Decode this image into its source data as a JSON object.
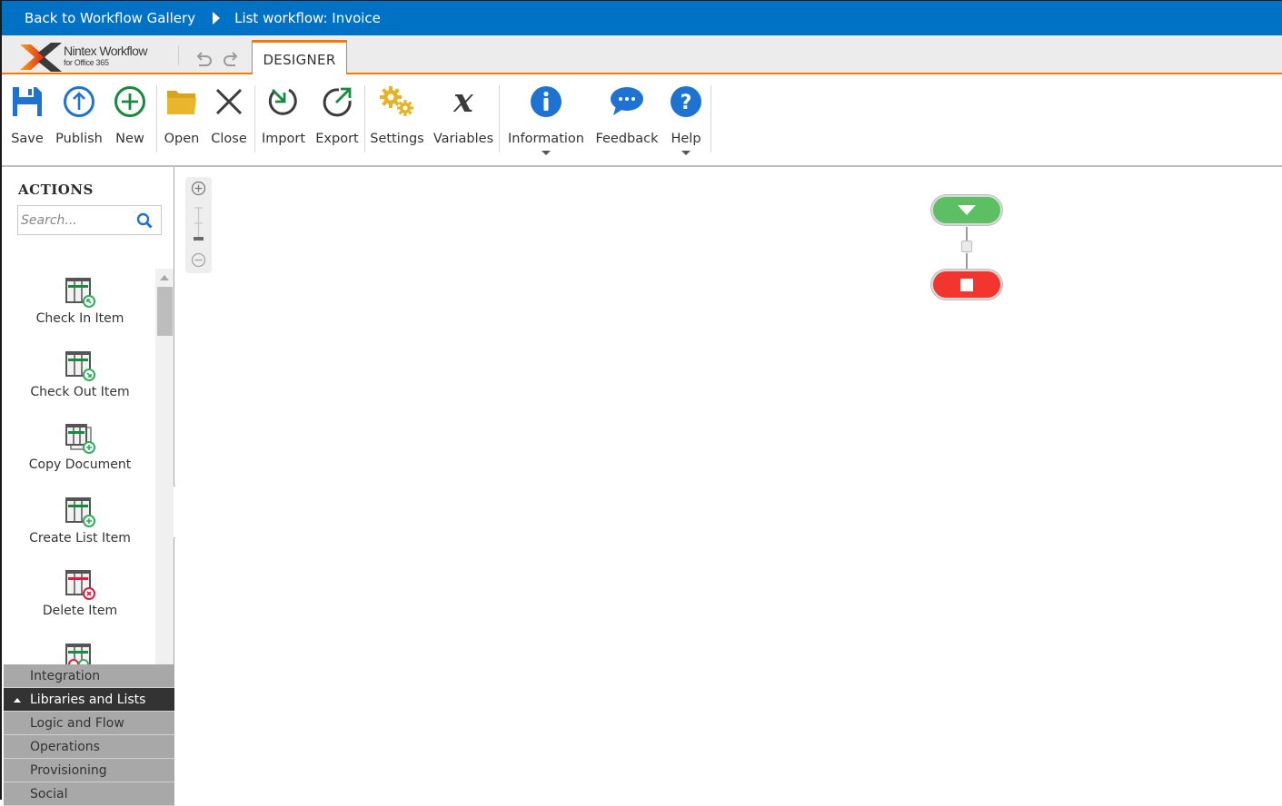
{
  "topbar": {
    "back_link": "Back to Workflow Gallery",
    "current": "List workflow: Invoice"
  },
  "brand": {
    "name": "Nintex Workflow",
    "sub": "for Office 365"
  },
  "tabs": [
    {
      "label": "DESIGNER",
      "active": true
    }
  ],
  "ribbon": {
    "buttons": [
      {
        "id": "save",
        "label": "Save",
        "icon": "save-icon"
      },
      {
        "id": "publish",
        "label": "Publish",
        "icon": "publish-icon"
      },
      {
        "id": "new",
        "label": "New",
        "icon": "plus-circle-icon"
      },
      {
        "id": "open",
        "label": "Open",
        "icon": "folder-icon"
      },
      {
        "id": "close",
        "label": "Close",
        "icon": "close-icon"
      },
      {
        "id": "import",
        "label": "Import",
        "icon": "import-icon"
      },
      {
        "id": "export",
        "label": "Export",
        "icon": "export-icon"
      },
      {
        "id": "settings",
        "label": "Settings",
        "icon": "gears-icon"
      },
      {
        "id": "variables",
        "label": "Variables",
        "icon": "variable-x-icon"
      },
      {
        "id": "information",
        "label": "Information",
        "icon": "info-icon",
        "dropdown": true
      },
      {
        "id": "feedback",
        "label": "Feedback",
        "icon": "chat-bubble-icon"
      },
      {
        "id": "help",
        "label": "Help",
        "icon": "help-icon",
        "dropdown": true
      }
    ]
  },
  "actions_panel": {
    "title": "ACTIONS",
    "search_placeholder": "Search...",
    "items": [
      {
        "label": "Check In Item",
        "icon": "check-in-item-icon"
      },
      {
        "label": "Check Out Item",
        "icon": "check-out-item-icon"
      },
      {
        "label": "Copy Document",
        "icon": "copy-document-icon"
      },
      {
        "label": "Create List Item",
        "icon": "create-list-item-icon"
      },
      {
        "label": "Delete Item",
        "icon": "delete-item-icon"
      },
      {
        "label": "",
        "icon": "list-action-icon"
      }
    ],
    "categories": [
      {
        "label": "Integration",
        "active": false
      },
      {
        "label": "Libraries and Lists",
        "active": true
      },
      {
        "label": "Logic and Flow",
        "active": false
      },
      {
        "label": "Operations",
        "active": false
      },
      {
        "label": "Provisioning",
        "active": false
      },
      {
        "label": "Social",
        "active": false
      }
    ]
  },
  "colors": {
    "topbar": "#0072c6",
    "accent_orange": "#f07d00",
    "start_green": "#5cbf63",
    "end_red": "#f2362f",
    "icon_blue": "#1e73d2",
    "icon_green": "#168a3d",
    "icon_gold": "#e6b325"
  }
}
